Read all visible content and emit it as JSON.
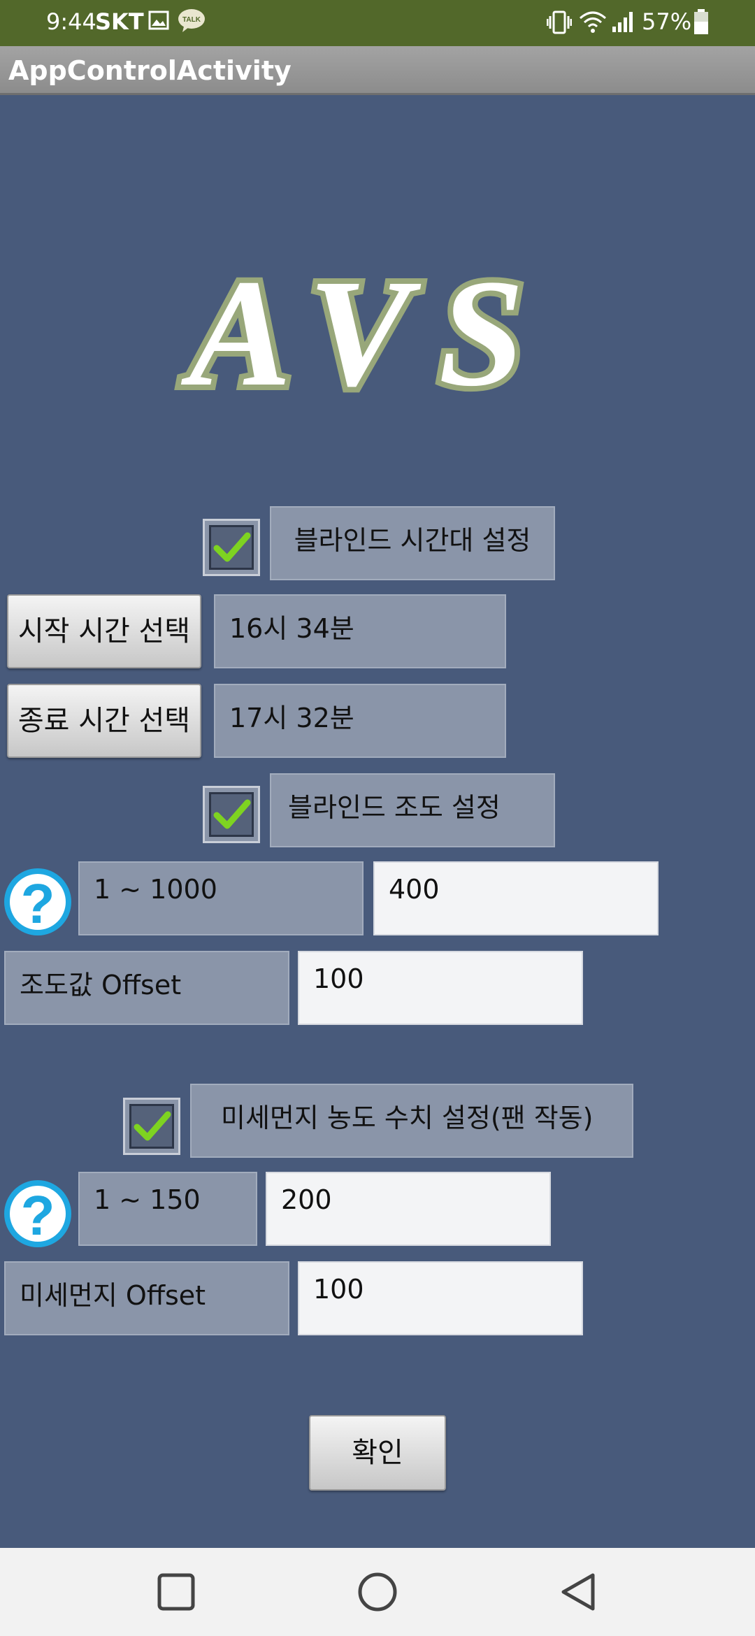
{
  "status_bar": {
    "time": "9:44",
    "carrier": "SKT",
    "battery": "57%",
    "icons": [
      "image-icon",
      "kakaotalk-icon",
      "vibrate-icon",
      "wifi-icon",
      "signal-icon",
      "battery-icon"
    ],
    "kakao_label": "TALK",
    "bg_color": "#52682a"
  },
  "app_bar": {
    "title": "AppControlActivity"
  },
  "logo": {
    "text": "AVS"
  },
  "blind_time": {
    "checkbox_checked": true,
    "label": "블라인드 시간대 설정",
    "start_button": "시작 시간 선택",
    "start_value": "16시 34분",
    "end_button": "종료 시간 선택",
    "end_value": "17시 32분"
  },
  "blind_lux": {
    "checkbox_checked": true,
    "label": "블라인드 조도 설정",
    "range_label": "1 ~ 1000",
    "value": "400",
    "offset_label": "조도값 Offset",
    "offset_value": "100"
  },
  "dust": {
    "checkbox_checked": true,
    "label": "미세먼지 농도 수치 설정(팬 작동)",
    "range_label": "1 ~ 150",
    "value": "200",
    "offset_label": "미세먼지 Offset",
    "offset_value": "100"
  },
  "confirm_button": "확인",
  "nav": {
    "icons": [
      "recents-icon",
      "home-icon",
      "back-icon"
    ]
  },
  "colors": {
    "background": "#485a7b",
    "panel": "#8a95a9",
    "check": "#7ed321",
    "help": "#1ea7e1"
  }
}
